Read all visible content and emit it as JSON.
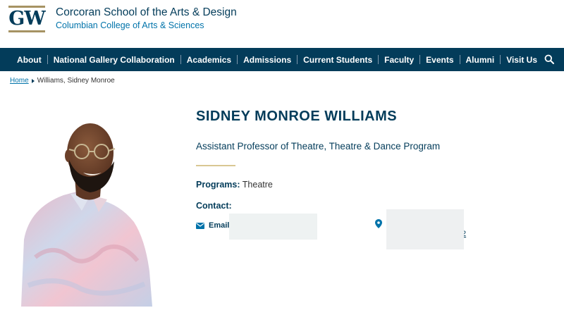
{
  "header": {
    "logo_text": "GW",
    "school_name": "Corcoran School of the Arts & Design",
    "college_name": "Columbian College of Arts & Sciences"
  },
  "nav": {
    "items": [
      {
        "label": "About"
      },
      {
        "label": "National Gallery Collaboration"
      },
      {
        "label": "Academics"
      },
      {
        "label": "Admissions"
      },
      {
        "label": "Current Students"
      },
      {
        "label": "Faculty"
      },
      {
        "label": "Events"
      },
      {
        "label": "Alumni"
      },
      {
        "label": "Visit Us"
      }
    ],
    "search_icon": "search-icon"
  },
  "breadcrumb": {
    "home": "Home",
    "current": "Williams, Sidney Monroe"
  },
  "profile": {
    "name": "SIDNEY MONROE WILLIAMS",
    "title": "Assistant Professor of Theatre, Theatre & Dance Program",
    "programs_label": "Programs:",
    "programs_value": "Theatre",
    "contact_label": "Contact:",
    "email_label": "Email",
    "location_icon": "map-pin-icon",
    "partial_text": "2"
  },
  "colors": {
    "navy": "#033c5a",
    "link_blue": "#0073aa",
    "gold": "#a69363",
    "divider_gold": "#d9c793"
  }
}
